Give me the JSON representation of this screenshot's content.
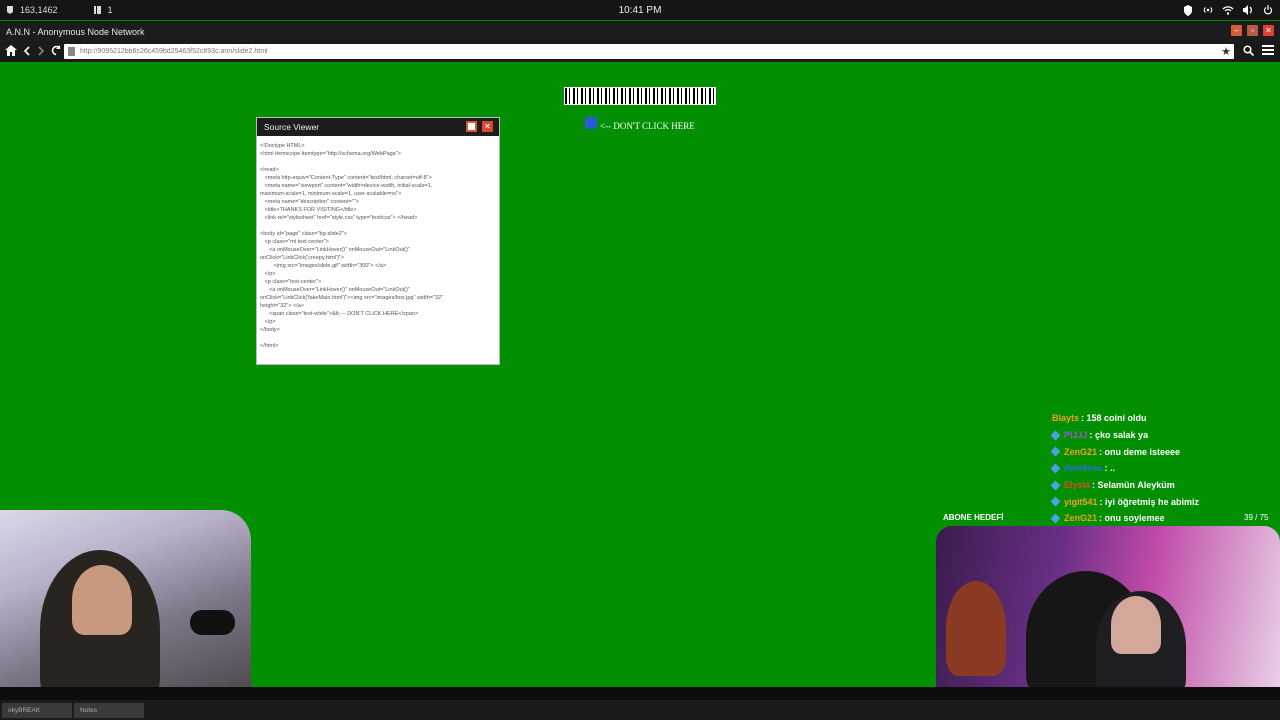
{
  "system_bar": {
    "left_value_1": "163,1462",
    "left_value_2": "1",
    "clock": "10:41 PM"
  },
  "window": {
    "title": "A.N.N - Anonymous Node Network"
  },
  "address_bar": {
    "url": "http://9095212bb6c26c459bd25463f52c893c.ann/slide2.html"
  },
  "page": {
    "dont_click_text": "<-- DON'T CLICK HERE"
  },
  "source_viewer": {
    "title": "Source Viewer",
    "code": "<!Doctype HTML>\n<html itemscope itemtype=\"http://schema.org/WebPage\">\n\n<head>\n   <meta http-equiv=\"Content-Type\" content=\"text/html; charset=utf-8\">\n   <meta name=\"viewport\" content=\"width=device-width, initial-scale=1,\nmaximum-scale=1, minimum-scale=1, user-scalable=no\">\n   <meta name=\"description\" content=\"\">\n   <title>THANKS FOR VISITING</title>\n   <link rel=\"stylesheet\" href=\"style.css\" type=\"text/css\"> </head>\n\n<body id=\"page\" class=\"bg-slide2\">\n   <p class=\"mt text-center\">\n      <a onMouseOver=\"LinkHover()\" onMouseOut=\"LinkOut()\"\nonClick=\"LinkClick('creepy.html')\">\n         <img src=\"images/slide.gif\" width=\"300\"> </a>\n   </p>\n   <p class=\"text-center\">\n      <a onMouseOver=\"LinkHover()\" onMouseOut=\"LinkOut()\"\nonClick=\"LinkClick('fakeMain.html')\"><img src=\"images/box.jpg\" width=\"32\"\nheight=\"32\"> </a>\n      <span class=\"text-white\">&lt;--- DON'T CLICK HERE</span>\n   </p>\n</body>\n\n</html>"
  },
  "chat": {
    "messages": [
      {
        "user": "Blayts",
        "text": " : 158 coini oldu",
        "color": "#f0a020"
      },
      {
        "user": "PlJJJ",
        "text": " : çko salak ya",
        "color": "#9b59d0"
      },
      {
        "user": "ZenG21",
        "text": " : onu deme isteeee",
        "color": "#f0a020"
      },
      {
        "user": "dimi9sse",
        "text": " : ..",
        "color": "#2b6cd8"
      },
      {
        "user": "Elysia",
        "text": " : Selamün Aleyküm",
        "color": "#e2452f"
      },
      {
        "user": "yigit541",
        "text": " : iyi öğretmiş he abimiz",
        "color": "#f0a020"
      },
      {
        "user": "ZenG21",
        "text": " : onu soylemee",
        "color": "#f0a020"
      }
    ],
    "goal_label": "ABONE HEDEFİ",
    "goal_count": "39 / 75"
  },
  "taskbar": {
    "items": [
      "okyBREAK",
      "Notes"
    ]
  }
}
